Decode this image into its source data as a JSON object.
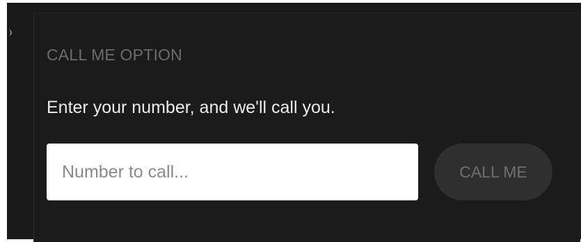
{
  "call_me": {
    "section_title": "CALL ME OPTION",
    "subtitle": "Enter your number, and we'll call you.",
    "input": {
      "placeholder": "Number to call...",
      "value": ""
    },
    "button_label": "CALL ME"
  }
}
